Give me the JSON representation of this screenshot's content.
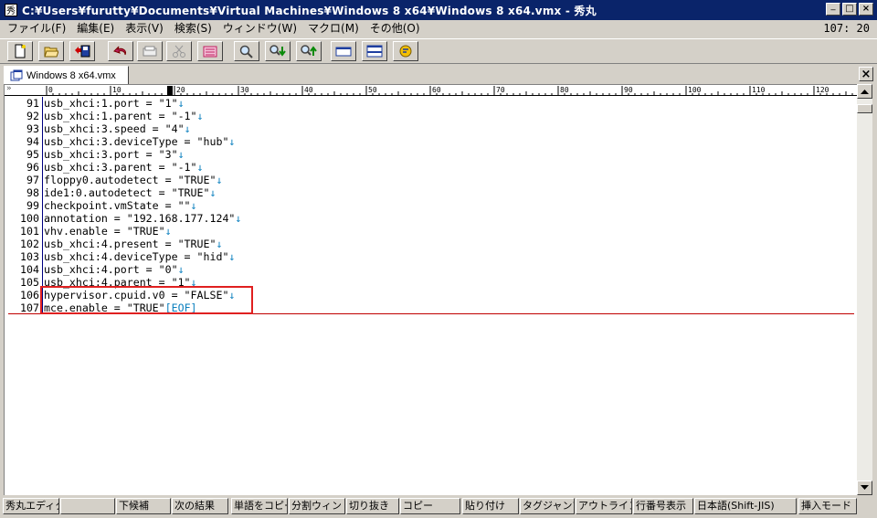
{
  "title_bar": {
    "title": "C:¥Users¥furutty¥Documents¥Virtual Machines¥Windows 8 x64¥Windows 8 x64.vmx - 秀丸",
    "minimize": "_",
    "maximize": "□",
    "close": "×"
  },
  "menu": {
    "items": [
      "ファイル(F)",
      "編集(E)",
      "表示(V)",
      "検索(S)",
      "ウィンドウ(W)",
      "マクロ(M)",
      "その他(O)"
    ],
    "cursor_position": "107: 20"
  },
  "tab": {
    "label": "Windows 8 x64.vmx"
  },
  "ruler": {
    "chevron": "»"
  },
  "editor": {
    "eol_mark": "↓",
    "eof_mark": "[EOF]",
    "lines": [
      {
        "n": "91",
        "text": "usb_xhci:1.port = \"1\""
      },
      {
        "n": "92",
        "text": "usb_xhci:1.parent = \"-1\""
      },
      {
        "n": "93",
        "text": "usb_xhci:3.speed = \"4\""
      },
      {
        "n": "94",
        "text": "usb_xhci:3.deviceType = \"hub\""
      },
      {
        "n": "95",
        "text": "usb_xhci:3.port = \"3\""
      },
      {
        "n": "96",
        "text": "usb_xhci:3.parent = \"-1\""
      },
      {
        "n": "97",
        "text": "floppy0.autodetect = \"TRUE\""
      },
      {
        "n": "98",
        "text": "ide1:0.autodetect = \"TRUE\""
      },
      {
        "n": "99",
        "text": "checkpoint.vmState = \"\""
      },
      {
        "n": "100",
        "text": "annotation = \"192.168.177.124\""
      },
      {
        "n": "101",
        "text": "vhv.enable = \"TRUE\""
      },
      {
        "n": "102",
        "text": "usb_xhci:4.present = \"TRUE\""
      },
      {
        "n": "103",
        "text": "usb_xhci:4.deviceType = \"hid\""
      },
      {
        "n": "104",
        "text": "usb_xhci:4.port = \"0\""
      },
      {
        "n": "105",
        "text": "usb_xhci:4.parent = \"1\""
      },
      {
        "n": "106",
        "text": "hypervisor.cpuid.v0 = \"FALSE\""
      },
      {
        "n": "107",
        "text": "mce.enable = \"TRUE\""
      }
    ]
  },
  "status_bar": {
    "keys": [
      "秀丸エディタへ",
      "",
      "下候補",
      "次の結果",
      "単語をコピー",
      "分割ウィンドウ",
      "切り抜き",
      "コピー",
      "貼り付け",
      "タグジャンプ",
      "アウトライン解析",
      "行番号表示",
      "日本語(Shift-JIS)",
      "挿入モード"
    ]
  },
  "colors": {
    "title_bg": "#0a246a",
    "eol_mark": "#0a7fbe",
    "highlight_box": "#e02020",
    "eof_rule": "#c00000"
  }
}
